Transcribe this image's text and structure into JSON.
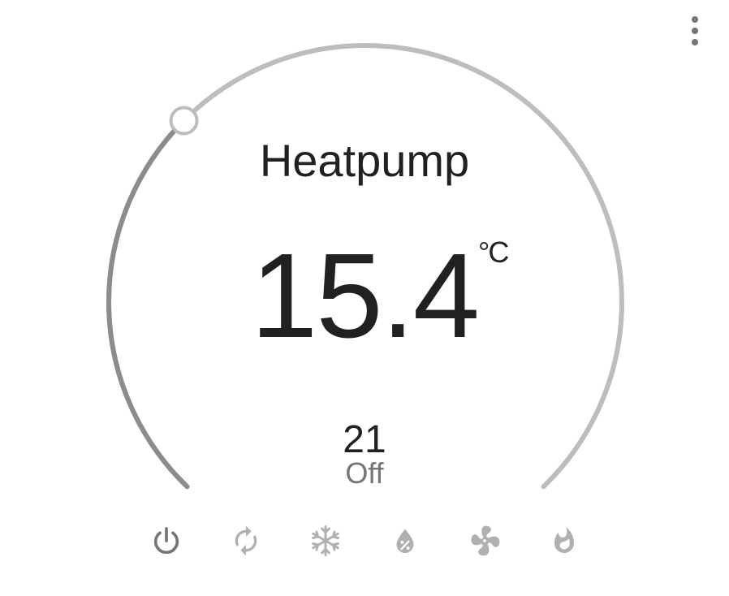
{
  "card": {
    "name": "Heatpump",
    "current_temperature": "15.4",
    "unit": "°C",
    "target_temperature": "21",
    "state": "Off",
    "setpoint_fraction": 0.0
  },
  "menu": {
    "icon": "dots-vertical-icon"
  },
  "modes": [
    {
      "name": "off",
      "icon": "power-icon",
      "active": true
    },
    {
      "name": "auto",
      "icon": "autorenew-icon",
      "active": false
    },
    {
      "name": "cool",
      "icon": "snowflake-icon",
      "active": false
    },
    {
      "name": "dry",
      "icon": "water-percent-icon",
      "active": false
    },
    {
      "name": "fan_only",
      "icon": "fan-icon",
      "active": false
    },
    {
      "name": "heat",
      "icon": "fire-icon",
      "active": false
    }
  ],
  "colors": {
    "arc_track": "#bdbdbd",
    "arc_active": "#9e9e9e",
    "active_icon": "#757575",
    "inactive_icon": "#b0b0b0",
    "text_primary": "#212121",
    "text_secondary": "#757575"
  }
}
